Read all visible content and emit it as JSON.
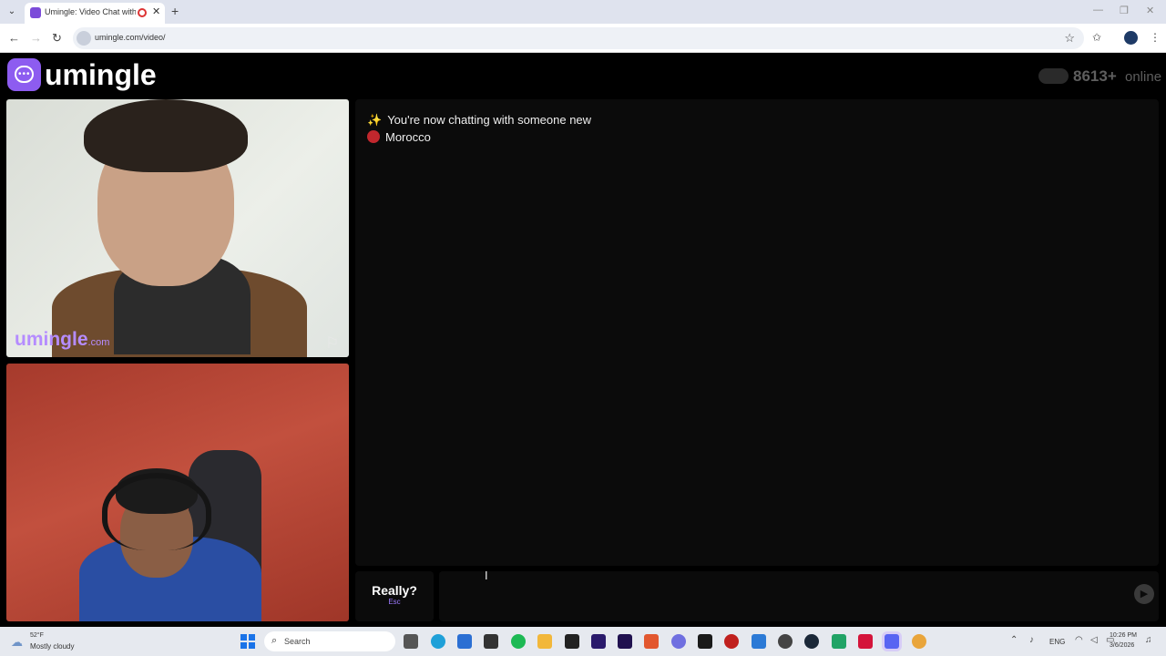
{
  "browser": {
    "tab_title": "Umingle: Video Chat with Str",
    "url": "umingle.com/video/",
    "new_tab": "+",
    "tab_close": "✕"
  },
  "site": {
    "logo_text": "umingle",
    "online_count": "8613+",
    "online_label": "online"
  },
  "videos": {
    "watermark": "umingle",
    "watermark_suffix": ".com"
  },
  "chat": {
    "system_message": "You're now chatting with someone new",
    "country": "Morocco",
    "country_color": "#c1272d",
    "next_button": "Really?",
    "next_key": "Esc",
    "message_value": ""
  },
  "taskbar": {
    "weather_temp": "52°F",
    "weather_desc": "Mostly cloudy",
    "search_placeholder": "Search",
    "language": "ENG",
    "time": "10:26 PM",
    "date": "3/6/2026"
  },
  "colors": {
    "brand": "#8d5cf0",
    "watermark": "#b58cff",
    "background": "#000000",
    "panel": "#0b0b0b"
  }
}
